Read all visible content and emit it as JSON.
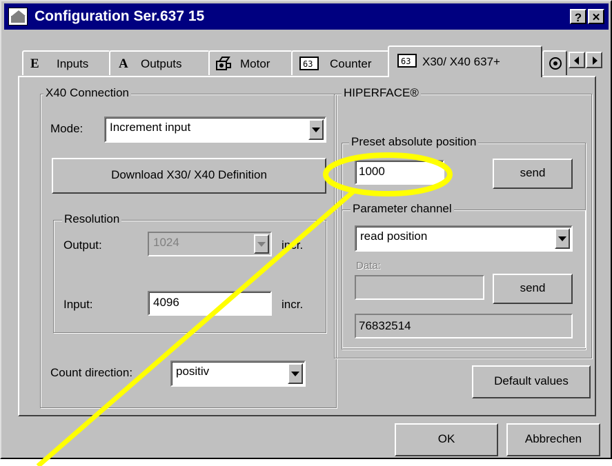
{
  "window": {
    "title": "Configuration Ser.637 15",
    "help_label": "?",
    "close_label": "✕"
  },
  "tabs": [
    {
      "letter": "E",
      "label": "Inputs"
    },
    {
      "letter": "A",
      "label": "Outputs"
    },
    {
      "label": "Motor"
    },
    {
      "label": "Counter"
    },
    {
      "label": "X30/ X40 637+",
      "active": true
    }
  ],
  "x40": {
    "group_title": "X40 Connection",
    "mode_label": "Mode:",
    "mode_value": "Increment input",
    "download_label": "Download X30/ X40 Definition",
    "resolution": {
      "group_title": "Resolution",
      "output_label": "Output:",
      "output_value": "1024",
      "output_unit": "incr.",
      "input_label": "Input:",
      "input_value": "4096",
      "input_unit": "incr."
    },
    "count_direction_label": "Count direction:",
    "count_direction_value": "positiv"
  },
  "hiperface": {
    "group_title": "HIPERFACE®",
    "preset": {
      "group_title": "Preset absolute position",
      "value": "1000",
      "send_label": "send"
    },
    "param": {
      "group_title": "Parameter channel",
      "value": "read position",
      "data_label": "Data:",
      "data_value": "",
      "send_label": "send",
      "result": "76832514"
    },
    "default_label": "Default values"
  },
  "footer": {
    "ok_label": "OK",
    "cancel_label": "Abbrechen"
  },
  "colors": {
    "titlebar": "#000080",
    "face": "#c0c0c0",
    "highlight_annotation": "#ffff00"
  }
}
